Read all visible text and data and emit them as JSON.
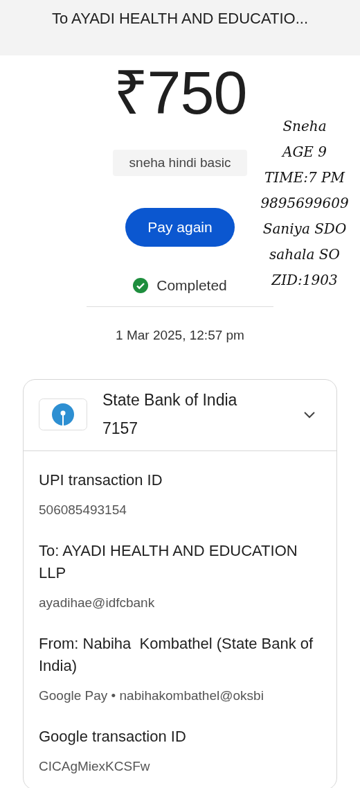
{
  "header": {
    "title": "To AYADI HEALTH AND EDUCATIO..."
  },
  "amount": "₹750",
  "note": "sneha hindi basic",
  "pay_again_button": "Pay again",
  "status": {
    "label": "Completed",
    "kind": "completed"
  },
  "datetime": "1 Mar 2025, 12:57 pm",
  "annotation": [
    "Sneha",
    "AGE 9",
    "TIME:7 PM",
    "9895699609",
    "Saniya SDO",
    "sahala SO",
    "ZID:1903"
  ],
  "account": {
    "bank": "State Bank of India",
    "number": "7157",
    "expanded": false
  },
  "details": [
    {
      "label": "UPI transaction ID",
      "value": "506085493154"
    },
    {
      "label": "To: AYADI HEALTH AND EDUCATION LLP",
      "value": "ayadihae@idfcbank"
    },
    {
      "label": "From: Nabiha  Kombathel (State Bank of India)",
      "value": "Google Pay • nabihakombathel@oksbi"
    },
    {
      "label": "Google transaction ID",
      "value": "CICAgMiexKCSFw"
    }
  ]
}
